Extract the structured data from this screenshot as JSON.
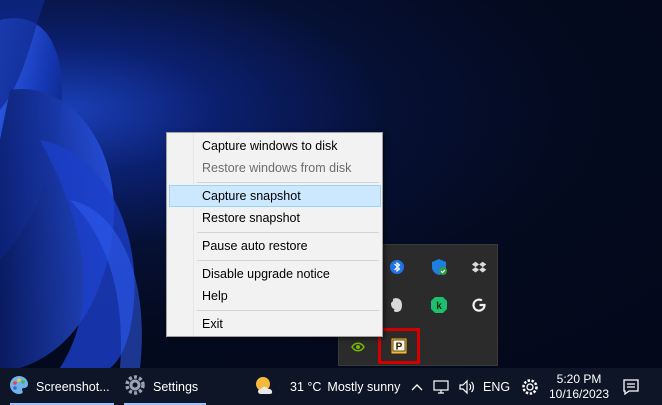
{
  "context_menu": {
    "items": [
      {
        "label": "Capture windows to disk",
        "state": "normal"
      },
      {
        "label": "Restore windows from disk",
        "state": "disabled"
      },
      {
        "label": "Capture snapshot",
        "state": "selected"
      },
      {
        "label": "Restore snapshot",
        "state": "normal"
      },
      {
        "label": "Pause auto restore",
        "state": "normal"
      },
      {
        "label": "Disable upgrade notice",
        "state": "normal"
      },
      {
        "label": "Help",
        "state": "normal"
      },
      {
        "label": "Exit",
        "state": "normal"
      }
    ]
  },
  "tray_flyout": {
    "icons": [
      "bluetooth-icon",
      "windows-security-icon",
      "dropbox-icon",
      "evernote-icon",
      "kaspersky-icon",
      "logitech-g-icon",
      "nvidia-icon",
      "persistent-windows-icon"
    ],
    "highlight_color": "#d40000"
  },
  "taskbar": {
    "app1_label": "Screenshot...",
    "app2_label": "Settings",
    "weather_temp": "31 °C",
    "weather_desc": "Mostly sunny",
    "language": "ENG",
    "time": "5:20 PM",
    "date": "10/16/2023"
  },
  "colors": {
    "taskbar_bg": "#0d1526",
    "menu_bg": "#f2f2f2",
    "selection_bg": "#cce8ff",
    "selection_border": "#99d1ff"
  }
}
